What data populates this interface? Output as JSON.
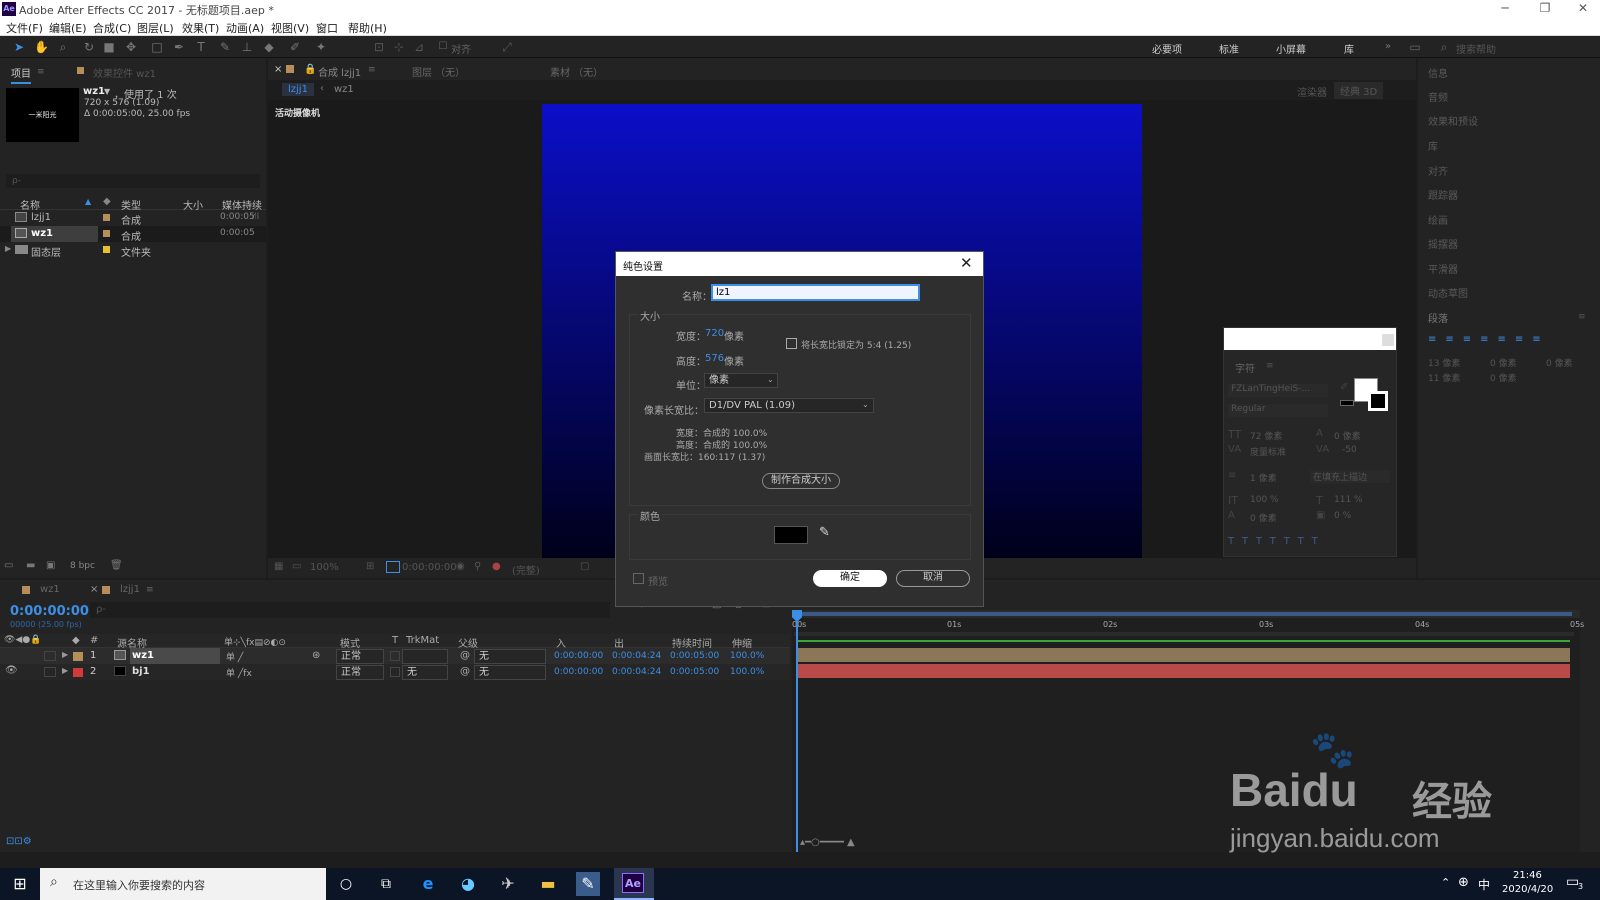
{
  "window": {
    "title": "Adobe After Effects CC 2017 - 无标题项目.aep *",
    "logo": "Ae"
  },
  "menu": [
    "文件(F)",
    "编辑(E)",
    "合成(C)",
    "图层(L)",
    "效果(T)",
    "动画(A)",
    "视图(V)",
    "窗口",
    "帮助(H)"
  ],
  "toolbar": {
    "align_label": "对齐",
    "workspaces": [
      "必要项",
      "标准",
      "小屏幕",
      "库"
    ],
    "search_placeholder": "搜索帮助"
  },
  "project_panel": {
    "tab_project": "项目",
    "tab_effects": "效果控件 wz1",
    "preview": {
      "thumb_text": "一米阳光",
      "name": "wz1",
      "used": "，使用了 1 次",
      "dims": "720 x 576 (1.09)",
      "duration": "Δ 0:00:05:00, 25.00 fps"
    },
    "search_placeholder": "ρ-",
    "columns": [
      "名称",
      "类型",
      "大小",
      "媒体持续"
    ],
    "items": [
      {
        "name": "lzjj1",
        "type": "合成",
        "duration": "0:00:05",
        "color": "#b58e5a",
        "selected": false
      },
      {
        "name": "wz1",
        "type": "合成",
        "duration": "0:00:05",
        "color": "#b58e5a",
        "selected": true
      },
      {
        "name": "固态层",
        "type": "文件夹",
        "duration": "",
        "color": "#e5c22d",
        "selected": false
      }
    ],
    "bpc": "8 bpc"
  },
  "comp_panel": {
    "tab_comp": "合成 lzjj1",
    "tab_layer": "图层 （无）",
    "tab_footage": "素材 （无）",
    "crumb_1": "lzjj1",
    "crumb_2": "wz1",
    "camera_label": "活动摄像机",
    "renderer": "渲染器",
    "renderer_mode": "经典 3D",
    "zoom": "100%",
    "time": "0:00:00:00",
    "view_mode": "(完整)",
    "canvas_colors": {
      "top": "#0b0fc8",
      "bottom": "#00001a"
    }
  },
  "right_panel": {
    "items": [
      "信息",
      "音频",
      "效果和预设",
      "库",
      "对齐",
      "跟踪器",
      "绘画",
      "摇摆器",
      "平滑器",
      "动态草图",
      "段落"
    ],
    "para_values": [
      "13 像素",
      "0 像素",
      "0 像素",
      "11 像素",
      "0 像素"
    ],
    "char_panel": {
      "title": "字符",
      "font": "FZLanTingHeiS-...",
      "style": "Regular",
      "size": "72 像素",
      "leading": "0 像素",
      "kerning": "度量标准",
      "tracking": "-50",
      "stroke": "1 像素",
      "stroke_mode": "在填充上描边",
      "vscale": "100 %",
      "hscale": "111 %",
      "baseline": "0 像素",
      "tsume": "0 %"
    }
  },
  "dialog": {
    "title": "纯色设置",
    "name_label": "名称：",
    "name_value": "lz1",
    "size_section": "大小",
    "width_label": "宽度：",
    "width_value": "720",
    "width_unit": "像素",
    "height_label": "高度：",
    "height_value": "576",
    "height_unit": "像素",
    "lock_label": "将长宽比锁定为 5:4 (1.25)",
    "unit_label": "单位：",
    "unit_value": "像素",
    "par_label": "像素长宽比：",
    "par_value": "D1/DV PAL (1.09)",
    "info_width": "宽度：合成的 100.0%",
    "info_height": "高度：合成的 100.0%",
    "info_frame": "画面长宽比：160:117 (1.37)",
    "make_comp_size": "制作合成大小",
    "color_section": "颜色",
    "color_value": "#000000",
    "preview_label": "预览",
    "ok": "确定",
    "cancel": "取消"
  },
  "timeline": {
    "tabs": [
      "wz1",
      "lzjj1"
    ],
    "time": "0:00:00:00",
    "fps": "00000 (25.00 fps)",
    "columns": [
      "源名称",
      "模式",
      "T",
      "TrkMat",
      "父级",
      "入",
      "出",
      "持续时间",
      "伸缩"
    ],
    "layers": [
      {
        "num": "1",
        "name": "wz1",
        "mode": "正常",
        "trkmat": "",
        "parent": "无",
        "in": "0:00:00:00",
        "out": "0:00:04:24",
        "dur": "0:00:05:00",
        "stretch": "100.0%",
        "color": "#b58e5a",
        "bar": "#8b7758"
      },
      {
        "num": "2",
        "name": "bj1",
        "mode": "正常",
        "trkmat": "无",
        "parent": "无",
        "in": "0:00:00:00",
        "out": "0:00:04:24",
        "dur": "0:00:05:00",
        "stretch": "100.0%",
        "color": "#d33b3b",
        "bar": "#b84a4a"
      }
    ],
    "ruler": [
      "00s",
      "01s",
      "02s",
      "03s",
      "04s",
      "05s"
    ]
  },
  "watermark": {
    "brand": "Baidu",
    "brand_cn": "经验",
    "url": "jingyan.baidu.com"
  },
  "taskbar": {
    "search_placeholder": "在这里输入你要搜索的内容",
    "clock_time": "21:46",
    "clock_date": "2020/4/20",
    "ime": "中",
    "notif": "3"
  }
}
